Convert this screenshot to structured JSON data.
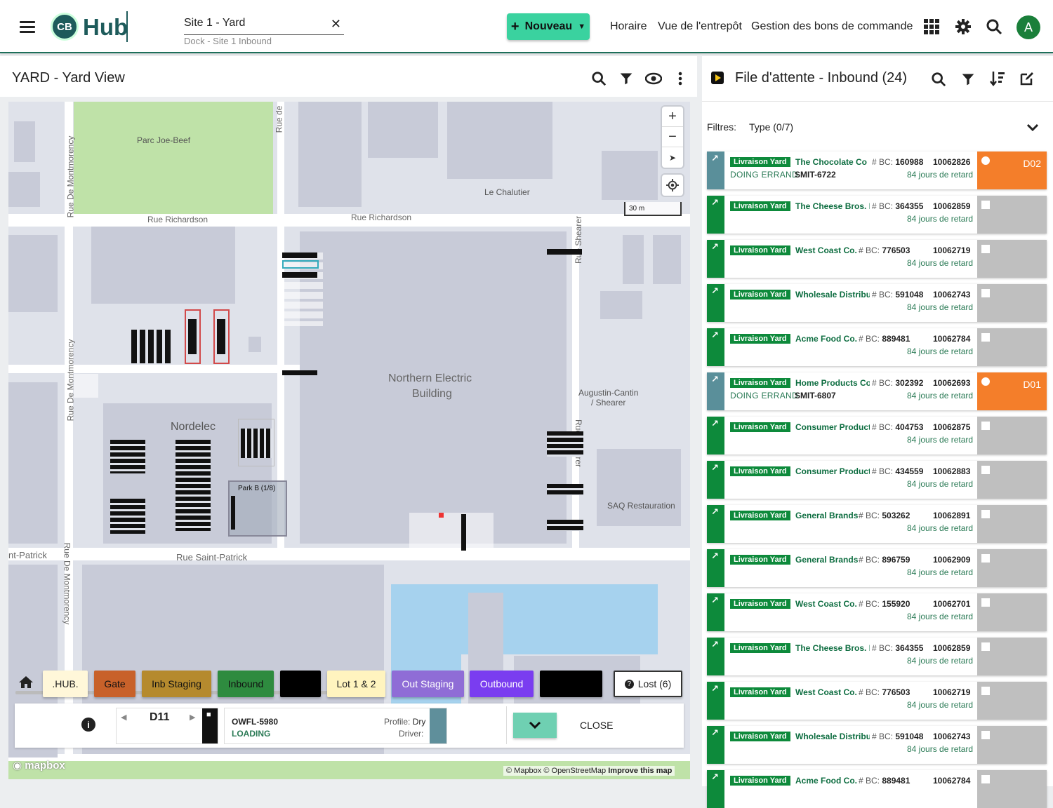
{
  "app": {
    "logo_mark": "CB",
    "logo_text": "Hub",
    "site_value": "Site 1 - Yard",
    "site_sub": "Dock - Site 1 Inbound",
    "new_button": "Nouveau",
    "nav": [
      "Horaire",
      "Vue de l'entrepôt",
      "Gestion des bons de commande"
    ],
    "avatar": "A",
    "accent": "#3ad29f",
    "brand": "#1e5b5b"
  },
  "yard": {
    "title": "YARD - Yard View",
    "labels": {
      "park": "Parc Joe-Beef",
      "chalutier": "Le Chalutier",
      "rue_richardson_1": "Rue Richardson",
      "rue_richardson_2": "Rue Richardson",
      "rue_de": "Rue de",
      "montmorency_1": "Rue De Montmorency",
      "montmorency_2": "Rue De Montmorency",
      "montmorency_3": "Rue De Montmorency",
      "shearer_1": "Rue Shearer",
      "shearer_2": "Rue Shearer",
      "building_1": "Northern Electric",
      "building_2": "Building",
      "nordelec": "Nordelec",
      "augustin_1": "Augustin-Cantin",
      "augustin_2": "/ Shearer",
      "saq": "SAQ Restauration",
      "park_b": "Park B (1/8)",
      "st_patrick_1": "nt-Patrick",
      "st_patrick_2": "Rue Saint-Patrick",
      "scale": "30 m",
      "mapbox": "mapbox",
      "attribution": "© Mapbox © OpenStreetMap",
      "improve": "Improve this map"
    },
    "zones": [
      {
        "label": ".HUB.",
        "color": "#fff7d9"
      },
      {
        "label": "Gate",
        "color": "#c8612a"
      },
      {
        "label": "Inb Staging",
        "color": "#b58a2e"
      },
      {
        "label": "Inbound",
        "color": "#2e8b3f"
      },
      {
        "label": "",
        "color": "#000000"
      },
      {
        "label": "Lot 1 & 2",
        "color": "#fff4bf"
      },
      {
        "label": "Out Staging",
        "color": "#8f6dd6"
      },
      {
        "label": "Outbound",
        "color": "#7a3df0"
      },
      {
        "label": "",
        "color": "#000000"
      }
    ],
    "lost_button": "Lost (6)",
    "dock": {
      "id": "D11",
      "trailer": "OWFL-5980",
      "status": "LOADING",
      "profile_label": "Profile:",
      "profile_value": "Dry",
      "driver_label": "Driver:",
      "close": "CLOSE"
    }
  },
  "queue": {
    "title": "File d'attente - Inbound (24)",
    "filters_label": "Filtres:",
    "filter_type": "Type (0/7)",
    "bc_label": "# BC:",
    "items": [
      {
        "badge": "Livraison Yard",
        "company": "The Chocolate Co",
        "bc": "160988",
        "num": "10062826",
        "late": "84 jours de retard",
        "status": "DOING ERRAND",
        "ref": "SMIT-6722",
        "dock": "D02",
        "active": true
      },
      {
        "badge": "Livraison Yard",
        "company": "The Cheese Bros. Inc",
        "bc": "364355",
        "num": "10062859",
        "late": "84 jours de retard",
        "status": "",
        "ref": "",
        "dock": "",
        "active": false
      },
      {
        "badge": "Livraison Yard",
        "company": "West Coast Co.",
        "bc": "776503",
        "num": "10062719",
        "late": "84 jours de retard",
        "status": "",
        "ref": "",
        "dock": "",
        "active": false
      },
      {
        "badge": "Livraison Yard",
        "company": "Wholesale Distributors",
        "bc": "591048",
        "num": "10062743",
        "late": "84 jours de retard",
        "status": "",
        "ref": "",
        "dock": "",
        "active": false
      },
      {
        "badge": "Livraison Yard",
        "company": "Acme Food Co.",
        "bc": "889481",
        "num": "10062784",
        "late": "84 jours de retard",
        "status": "",
        "ref": "",
        "dock": "",
        "active": false
      },
      {
        "badge": "Livraison Yard",
        "company": "Home Products Co",
        "bc": "302392",
        "num": "10062693",
        "late": "84 jours de retard",
        "status": "DOING ERRAND",
        "ref": "SMIT-6807",
        "dock": "D01",
        "active": true
      },
      {
        "badge": "Livraison Yard",
        "company": "Consumer Products",
        "bc": "404753",
        "num": "10062875",
        "late": "84 jours de retard",
        "status": "",
        "ref": "",
        "dock": "",
        "active": false
      },
      {
        "badge": "Livraison Yard",
        "company": "Consumer Products",
        "bc": "434559",
        "num": "10062883",
        "late": "84 jours de retard",
        "status": "",
        "ref": "",
        "dock": "",
        "active": false
      },
      {
        "badge": "Livraison Yard",
        "company": "General Brands",
        "bc": "503262",
        "num": "10062891",
        "late": "84 jours de retard",
        "status": "",
        "ref": "",
        "dock": "",
        "active": false
      },
      {
        "badge": "Livraison Yard",
        "company": "General Brands",
        "bc": "896759",
        "num": "10062909",
        "late": "84 jours de retard",
        "status": "",
        "ref": "",
        "dock": "",
        "active": false
      },
      {
        "badge": "Livraison Yard",
        "company": "West Coast Co.",
        "bc": "155920",
        "num": "10062701",
        "late": "84 jours de retard",
        "status": "",
        "ref": "",
        "dock": "",
        "active": false
      },
      {
        "badge": "Livraison Yard",
        "company": "The Cheese Bros. Inc",
        "bc": "364355",
        "num": "10062859",
        "late": "84 jours de retard",
        "status": "",
        "ref": "",
        "dock": "",
        "active": false
      },
      {
        "badge": "Livraison Yard",
        "company": "West Coast Co.",
        "bc": "776503",
        "num": "10062719",
        "late": "84 jours de retard",
        "status": "",
        "ref": "",
        "dock": "",
        "active": false
      },
      {
        "badge": "Livraison Yard",
        "company": "Wholesale Distributors",
        "bc": "591048",
        "num": "10062743",
        "late": "84 jours de retard",
        "status": "",
        "ref": "",
        "dock": "",
        "active": false
      },
      {
        "badge": "Livraison Yard",
        "company": "Acme Food Co.",
        "bc": "889481",
        "num": "10062784",
        "late": "",
        "status": "",
        "ref": "",
        "dock": "",
        "active": false
      }
    ],
    "active_color": "#f47e2a",
    "inactive_color": "#bfbfbf"
  }
}
